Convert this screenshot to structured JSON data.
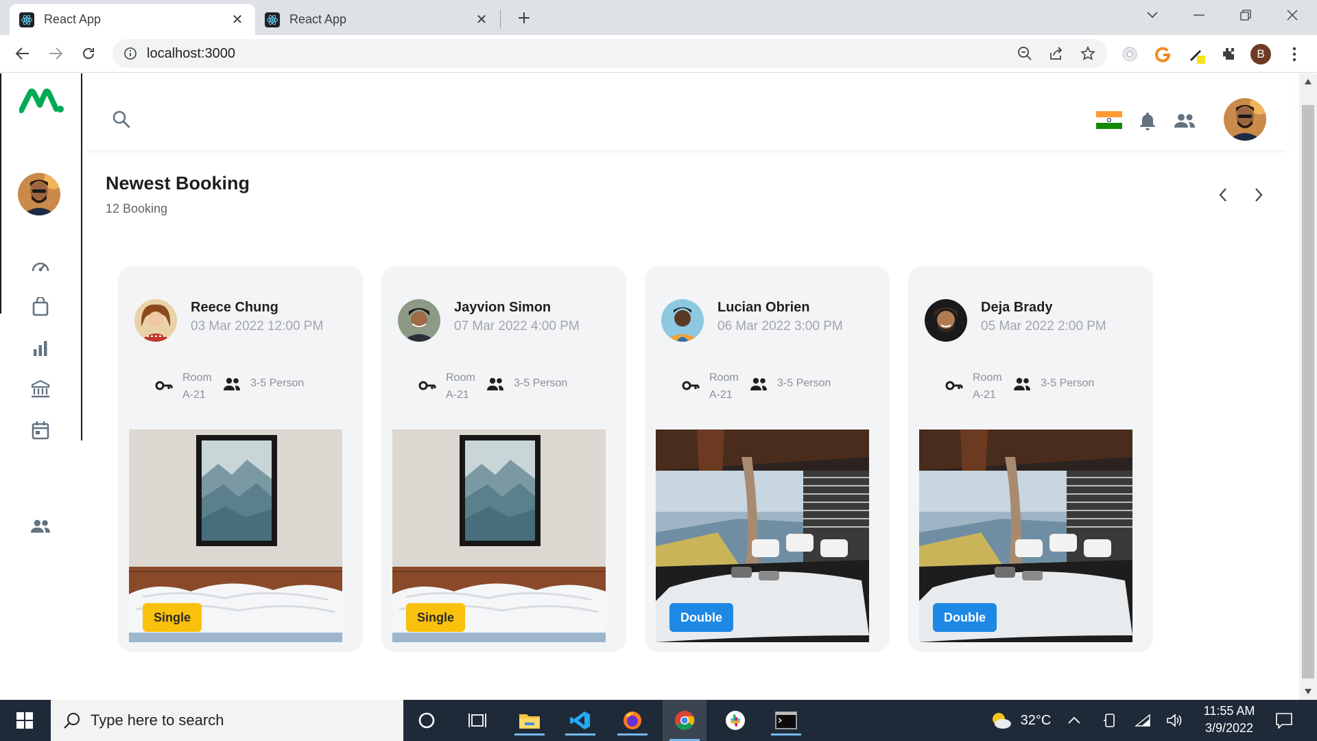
{
  "browser": {
    "tabs": [
      {
        "title": "React App",
        "active": true
      },
      {
        "title": "React App",
        "active": false
      }
    ],
    "url": "localhost:3000",
    "profile_initial": "B"
  },
  "app": {
    "section_title": "Newest Booking",
    "section_subtitle": "12 Booking",
    "bookings": [
      {
        "name": "Reece Chung",
        "date": "03 Mar 2022 12:00 PM",
        "room_label": "Room",
        "room_id": "A-21",
        "capacity": "3-5 Person",
        "type": "Single"
      },
      {
        "name": "Jayvion Simon",
        "date": "07 Mar 2022 4:00 PM",
        "room_label": "Room",
        "room_id": "A-21",
        "capacity": "3-5 Person",
        "type": "Single"
      },
      {
        "name": "Lucian Obrien",
        "date": "06 Mar 2022 3:00 PM",
        "room_label": "Room",
        "room_id": "A-21",
        "capacity": "3-5 Person",
        "type": "Double"
      },
      {
        "name": "Deja Brady",
        "date": "05 Mar 2022 2:00 PM",
        "room_label": "Room",
        "room_id": "A-21",
        "capacity": "3-5 Person",
        "type": "Double"
      }
    ],
    "colors": {
      "brand_green": "#00ab55",
      "single_badge": "#f9c10b",
      "double_badge": "#1e88e5"
    }
  },
  "taskbar": {
    "search_placeholder": "Type here to search",
    "weather": "32°C",
    "time": "11:55 AM",
    "date": "3/9/2022"
  }
}
